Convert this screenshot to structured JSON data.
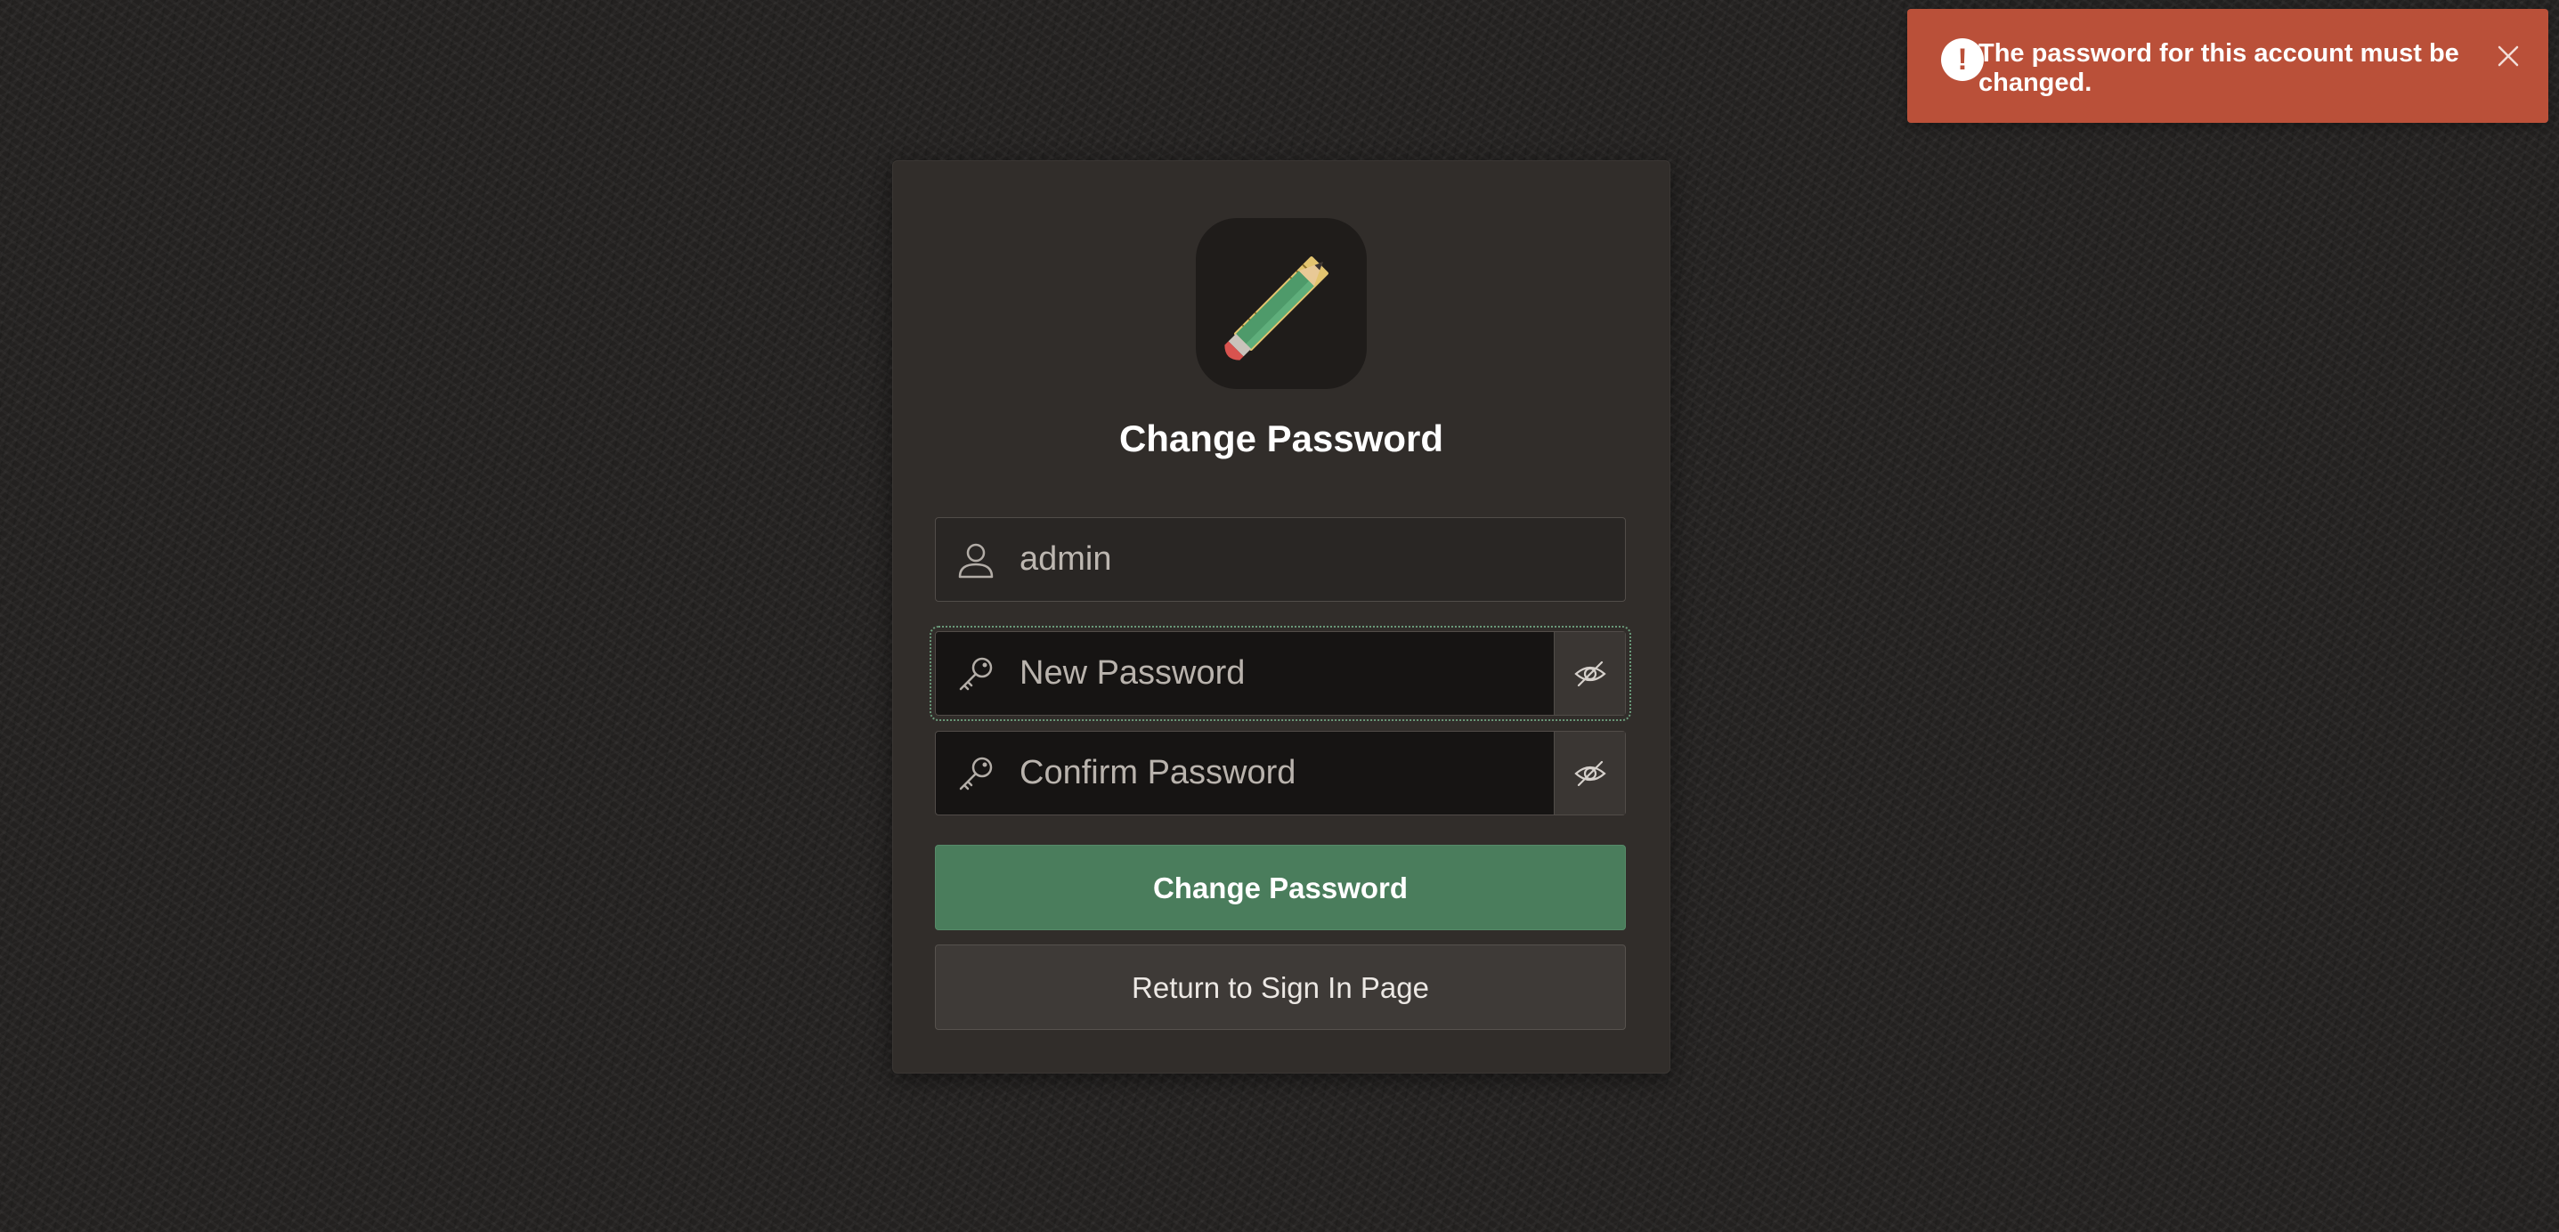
{
  "alert": {
    "message": "The password for this account must be changed.",
    "icon": "exclamation-icon",
    "close_icon": "close-icon",
    "color": "#ba5039"
  },
  "card": {
    "logo_icon": "pencil-ruler-icon",
    "title": "Change Password"
  },
  "form": {
    "username": {
      "value": "admin",
      "icon": "user-icon"
    },
    "new_password": {
      "placeholder": "New Password",
      "icon": "key-icon",
      "toggle_icon": "eye-slash-icon"
    },
    "confirm_password": {
      "placeholder": "Confirm Password",
      "icon": "key-icon",
      "toggle_icon": "eye-slash-icon"
    },
    "submit_label": "Change Password",
    "return_label": "Return to Sign In Page"
  },
  "colors": {
    "background": "#232120",
    "card": "#312d2a",
    "primary_button": "#4a7d5c",
    "secondary_button": "#3e3a37"
  }
}
